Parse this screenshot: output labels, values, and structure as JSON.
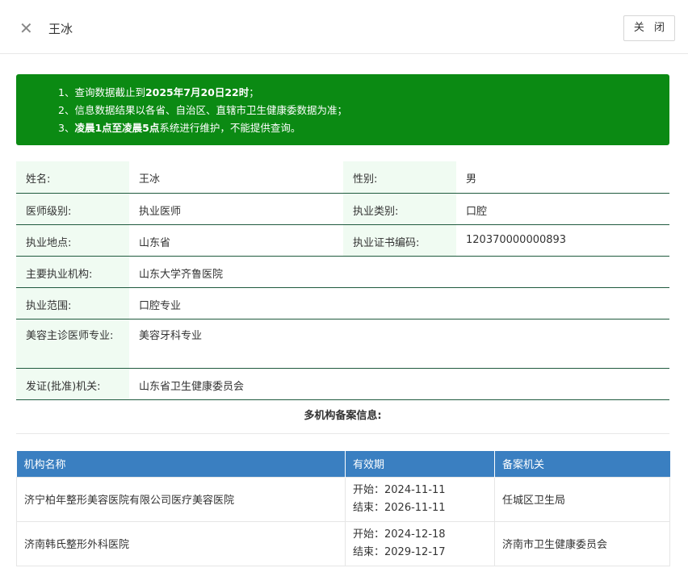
{
  "header": {
    "title": "王冰",
    "close_label": "关 闭"
  },
  "notice": {
    "line1_prefix": "1、查询数据截止到",
    "line1_bold": "2025年7月20日22时",
    "line1_suffix": "；",
    "line2": "2、信息数据结果以各省、自治区、直辖市卫生健康委数据为准；",
    "line3_prefix": "3、",
    "line3_bold": "凌晨1点至凌晨5点",
    "line3_suffix": "系统进行维护，不能提供查询。"
  },
  "info": {
    "name_label": "姓名:",
    "name_value": "王冰",
    "gender_label": "性别:",
    "gender_value": "男",
    "level_label": "医师级别:",
    "level_value": "执业医师",
    "category_label": "执业类别:",
    "category_value": "口腔",
    "location_label": "执业地点:",
    "location_value": "山东省",
    "cert_label": "执业证书编码:",
    "cert_value": "120370000000893",
    "org_label": "主要执业机构:",
    "org_value": "山东大学齐鲁医院",
    "scope_label": "执业范围:",
    "scope_value": "口腔专业",
    "cosmetic_label": "美容主诊医师专业:",
    "cosmetic_value": "美容牙科专业",
    "issuer_label": "发证(批准)机关:",
    "issuer_value": "山东省卫生健康委员会"
  },
  "multi_org": {
    "heading": "多机构备案信息:",
    "columns": [
      "机构名称",
      "有效期",
      "备案机关"
    ],
    "rows": [
      {
        "name": "济宁柏年整形美容医院有限公司医疗美容医院",
        "start": "开始：2024-11-11",
        "end": "结束：2026-11-11",
        "agency": "任城区卫生局"
      },
      {
        "name": "济南韩氏整形外科医院",
        "start": "开始：2024-12-18",
        "end": "结束：2029-12-17",
        "agency": "济南市卫生健康委员会"
      }
    ]
  },
  "icons": {
    "close": "close-icon"
  }
}
